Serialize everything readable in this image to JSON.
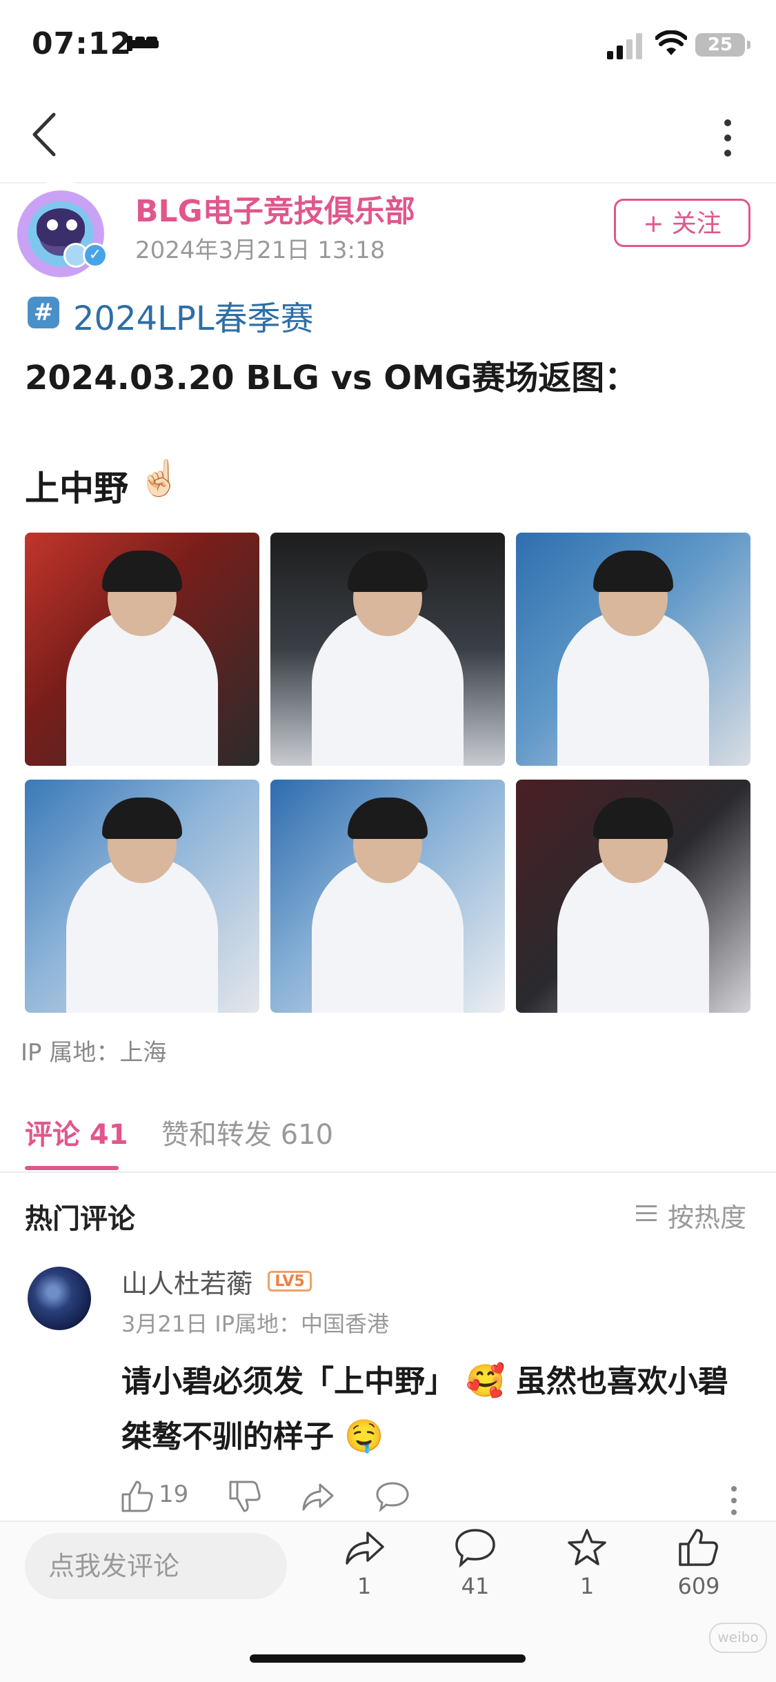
{
  "status_bar": {
    "time": "07:12",
    "battery": "25"
  },
  "post": {
    "author": "BLG电子竞技俱乐部",
    "date": "2024年3月21日 13:18",
    "follow_label": "+ 关注",
    "topic": "2024LPL春季赛",
    "topic_icon": "#",
    "headline": "2024.03.20 BLG vs OMG赛场返图：",
    "subline": "上中野",
    "subline_emoji": "☝🏻",
    "ip": "IP 属地：上海"
  },
  "tabs": {
    "comments": "评论 41",
    "reposts": "赞和转发 610"
  },
  "comments_section": {
    "title": "热门评论",
    "sort_label": "按热度"
  },
  "comment": {
    "user": "山人杜若蘅",
    "level": "LV5",
    "meta": "3月21日  IP属地：中国香港",
    "text_a": "请小碧必须发「上中野」",
    "emoji_a": "🥰",
    "text_b": " 虽然也喜欢小碧桀骜不驯的样子",
    "emoji_b": "🤤",
    "likes": "19"
  },
  "bottom_bar": {
    "input_placeholder": "点我发评论",
    "repost_count": "1",
    "comment_count": "41",
    "favorite_count": "1",
    "like_count": "609"
  },
  "watermark": "weibo",
  "colors": {
    "accent": "#e0568d",
    "topic": "#2d6ea6"
  },
  "icons": [
    "back-icon",
    "more-icon",
    "signal-icon",
    "wifi-icon",
    "bed-icon",
    "sort-icon",
    "like-icon",
    "dislike-icon",
    "share-icon",
    "comment-icon",
    "star-icon"
  ]
}
